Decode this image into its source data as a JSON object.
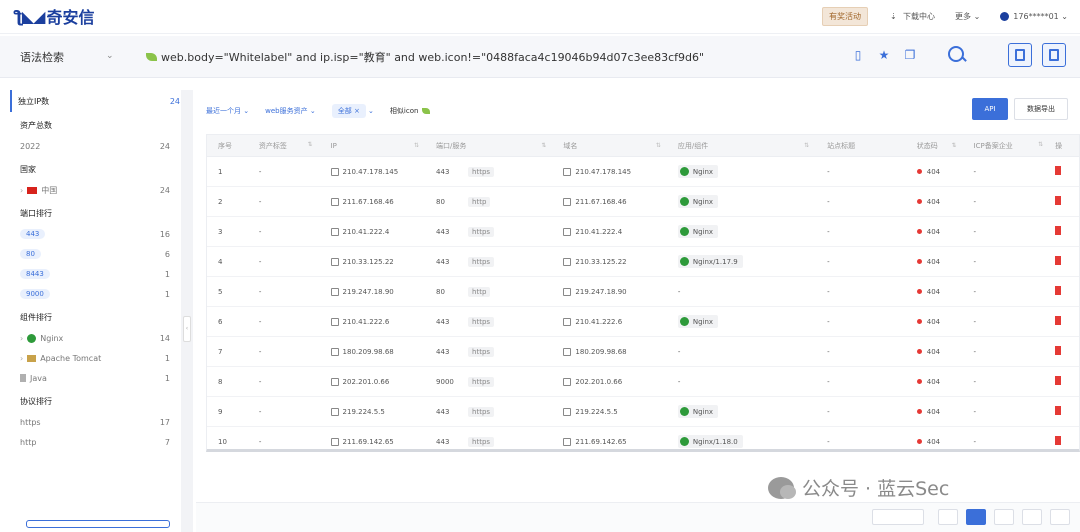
{
  "header": {
    "logo_text": "奇安信",
    "promo_label": "有奖活动",
    "download_center": "下载中心",
    "more": "更多",
    "user": "176*****01"
  },
  "search": {
    "mode": "语法检索",
    "query": "web.body=\"Whitelabel\" and ip.isp=\"教育\" and web.icon!=\"0488faca4c19046b94d07c3ee83cf9d6\""
  },
  "sidebar": {
    "independent_ip": {
      "label": "独立IP数",
      "count": "24"
    },
    "asset_total": {
      "label": "资产总数",
      "year": "2022",
      "count": "24"
    },
    "country": {
      "label": "国家",
      "items": [
        {
          "name": "中国",
          "count": "24"
        }
      ]
    },
    "port_rank": {
      "label": "端口排行",
      "items": [
        {
          "name": "443",
          "count": "16"
        },
        {
          "name": "80",
          "count": "6"
        },
        {
          "name": "8443",
          "count": "1"
        },
        {
          "name": "9000",
          "count": "1"
        }
      ]
    },
    "component_rank": {
      "label": "组件排行",
      "items": [
        {
          "name": "Nginx",
          "count": "14"
        },
        {
          "name": "Apache Tomcat",
          "count": "1"
        },
        {
          "name": "Java",
          "count": "1"
        }
      ]
    },
    "protocol_rank": {
      "label": "协议排行",
      "items": [
        {
          "name": "https",
          "count": "17"
        },
        {
          "name": "http",
          "count": "7"
        }
      ]
    }
  },
  "filters": {
    "time": "最近一个月",
    "web_assets": "web服务资产",
    "all": "全部",
    "similar_icon": "相似icon",
    "api": "API",
    "export": "数据导出"
  },
  "table": {
    "headers": [
      "序号",
      "资产标签",
      "IP",
      "端口/服务",
      "域名",
      "应用/组件",
      "站点标题",
      "状态码",
      "ICP备案企业",
      "操"
    ],
    "rows": [
      {
        "no": "1",
        "tag": "-",
        "ip": "210.47.178.145",
        "port": "443",
        "proto": "https",
        "domain": "210.47.178.145",
        "comp": "Nginx",
        "title": "-",
        "status": "404",
        "icp": "-"
      },
      {
        "no": "2",
        "tag": "-",
        "ip": "211.67.168.46",
        "port": "80",
        "proto": "http",
        "domain": "211.67.168.46",
        "comp": "Nginx",
        "title": "-",
        "status": "404",
        "icp": "-"
      },
      {
        "no": "3",
        "tag": "-",
        "ip": "210.41.222.4",
        "port": "443",
        "proto": "https",
        "domain": "210.41.222.4",
        "comp": "Nginx",
        "title": "-",
        "status": "404",
        "icp": "-"
      },
      {
        "no": "4",
        "tag": "-",
        "ip": "210.33.125.22",
        "port": "443",
        "proto": "https",
        "domain": "210.33.125.22",
        "comp": "Nginx/1.17.9",
        "title": "-",
        "status": "404",
        "icp": "-"
      },
      {
        "no": "5",
        "tag": "-",
        "ip": "219.247.18.90",
        "port": "80",
        "proto": "http",
        "domain": "219.247.18.90",
        "comp": "-",
        "title": "-",
        "status": "404",
        "icp": "-"
      },
      {
        "no": "6",
        "tag": "-",
        "ip": "210.41.222.6",
        "port": "443",
        "proto": "https",
        "domain": "210.41.222.6",
        "comp": "Nginx",
        "title": "-",
        "status": "404",
        "icp": "-"
      },
      {
        "no": "7",
        "tag": "-",
        "ip": "180.209.98.68",
        "port": "443",
        "proto": "https",
        "domain": "180.209.98.68",
        "comp": "-",
        "title": "-",
        "status": "404",
        "icp": "-"
      },
      {
        "no": "8",
        "tag": "-",
        "ip": "202.201.0.66",
        "port": "9000",
        "proto": "https",
        "domain": "202.201.0.66",
        "comp": "-",
        "title": "-",
        "status": "404",
        "icp": "-"
      },
      {
        "no": "9",
        "tag": "-",
        "ip": "219.224.5.5",
        "port": "443",
        "proto": "https",
        "domain": "219.224.5.5",
        "comp": "Nginx",
        "title": "-",
        "status": "404",
        "icp": "-"
      },
      {
        "no": "10",
        "tag": "-",
        "ip": "211.69.142.65",
        "port": "443",
        "proto": "https",
        "domain": "211.69.142.65",
        "comp": "Nginx/1.18.0",
        "title": "-",
        "status": "404",
        "icp": "-"
      }
    ]
  },
  "watermark": "公众号 · 蓝云Sec",
  "colors": {
    "accent": "#3b6fd9",
    "status_red": "#e53935",
    "nginx_green": "#2e9a3a"
  }
}
